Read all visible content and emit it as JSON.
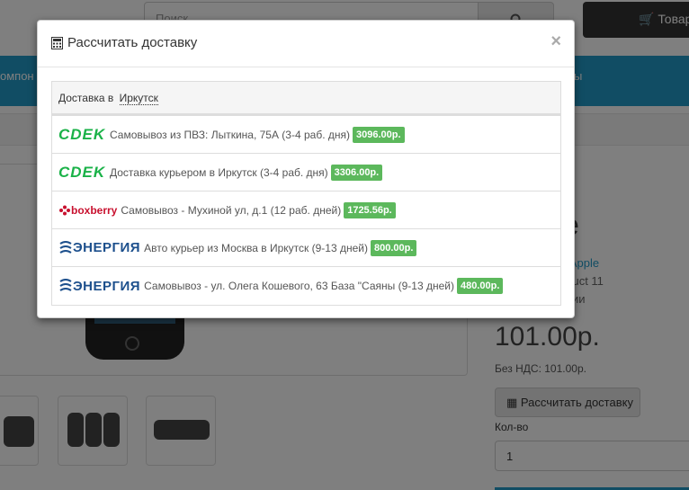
{
  "background": {
    "search_placeholder": "Поиск",
    "cart_label": "Товар",
    "nav_left": "омпон",
    "nav_right": "ы",
    "product_title": "е",
    "brand_prefix": "н",
    "brand_link": "Apple",
    "product_code": "oduct 11",
    "availability": "ичии",
    "price": "101.00р.",
    "ex_tax": "Без НДС: 101.00р.",
    "calc_button": "Рассчитать доставку",
    "qty_label": "Кол-во",
    "qty_value": "1"
  },
  "modal": {
    "title": "Рассчитать доставку",
    "close": "×",
    "header_prefix": "Доставка в",
    "city": "Иркутск",
    "options": [
      {
        "logo": "CDEK",
        "description": "Самовывоз из ПВЗ: Лыткина, 75А (3-4 раб. дня)",
        "price": "3096.00р."
      },
      {
        "logo": "CDEK",
        "description": "Доставка курьером в Иркутск (3-4 раб. дня)",
        "price": "3306.00р."
      },
      {
        "logo": "boxberry",
        "description": "Самовывоз - Мухиной ул, д.1 (12 раб. дней)",
        "price": "1725.56р."
      },
      {
        "logo": "ЭНЕРГИЯ",
        "description": "Авто курьер из Москва в Иркутск (9-13 дней)",
        "price": "800.00р."
      },
      {
        "logo": "ЭНЕРГИЯ",
        "description": "Самовывоз - ул. Олега Кошевого, 63 База \"Саяны (9-13 дней)",
        "price": "480.00р."
      }
    ]
  },
  "colors": {
    "accent": "#229ac8",
    "badge": "#5cb85c",
    "cdek": "#1ab248",
    "boxberry": "#c8102e",
    "energy": "#1c4f8c"
  }
}
